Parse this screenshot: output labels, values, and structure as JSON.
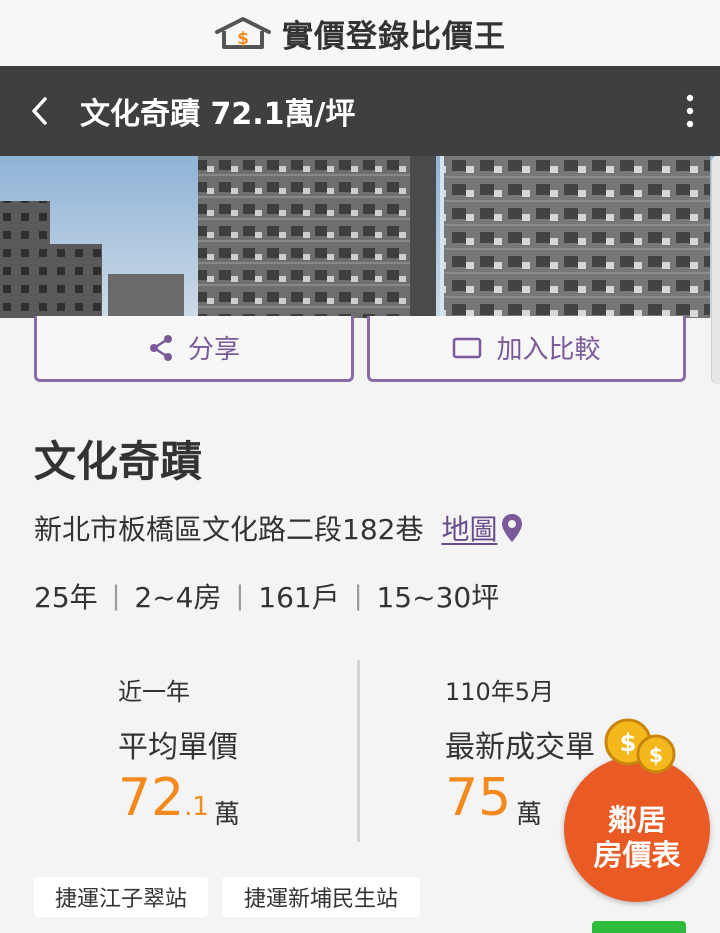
{
  "brand": {
    "name": "實價登錄比價王"
  },
  "app_bar": {
    "title": "文化奇蹟 72.1萬/坪"
  },
  "actions": {
    "share_label": "分享",
    "compare_label": "加入比較"
  },
  "community": {
    "name": "文化奇蹟",
    "address": "新北市板橋區文化路二段182巷",
    "map_label": "地圖",
    "specs": [
      "25年",
      "2~4房",
      "161戶",
      "15~30坪"
    ]
  },
  "stats": {
    "left": {
      "sub": "近一年",
      "label": "平均單價",
      "value_int": "72",
      "value_dec": ".1",
      "unit": "萬"
    },
    "right": {
      "sub": "110年5月",
      "label": "最新成交單",
      "value_int": "75",
      "unit": "萬"
    }
  },
  "tags": [
    "捷運江子翠站",
    "捷運新埔民生站"
  ],
  "promo": {
    "line1": "鄰居",
    "line2": "房價表"
  },
  "colors": {
    "accent": "#f28a1e",
    "purple": "#7a5a9a",
    "app_bar": "#3f3f3f",
    "promo": "#ea5a24"
  }
}
